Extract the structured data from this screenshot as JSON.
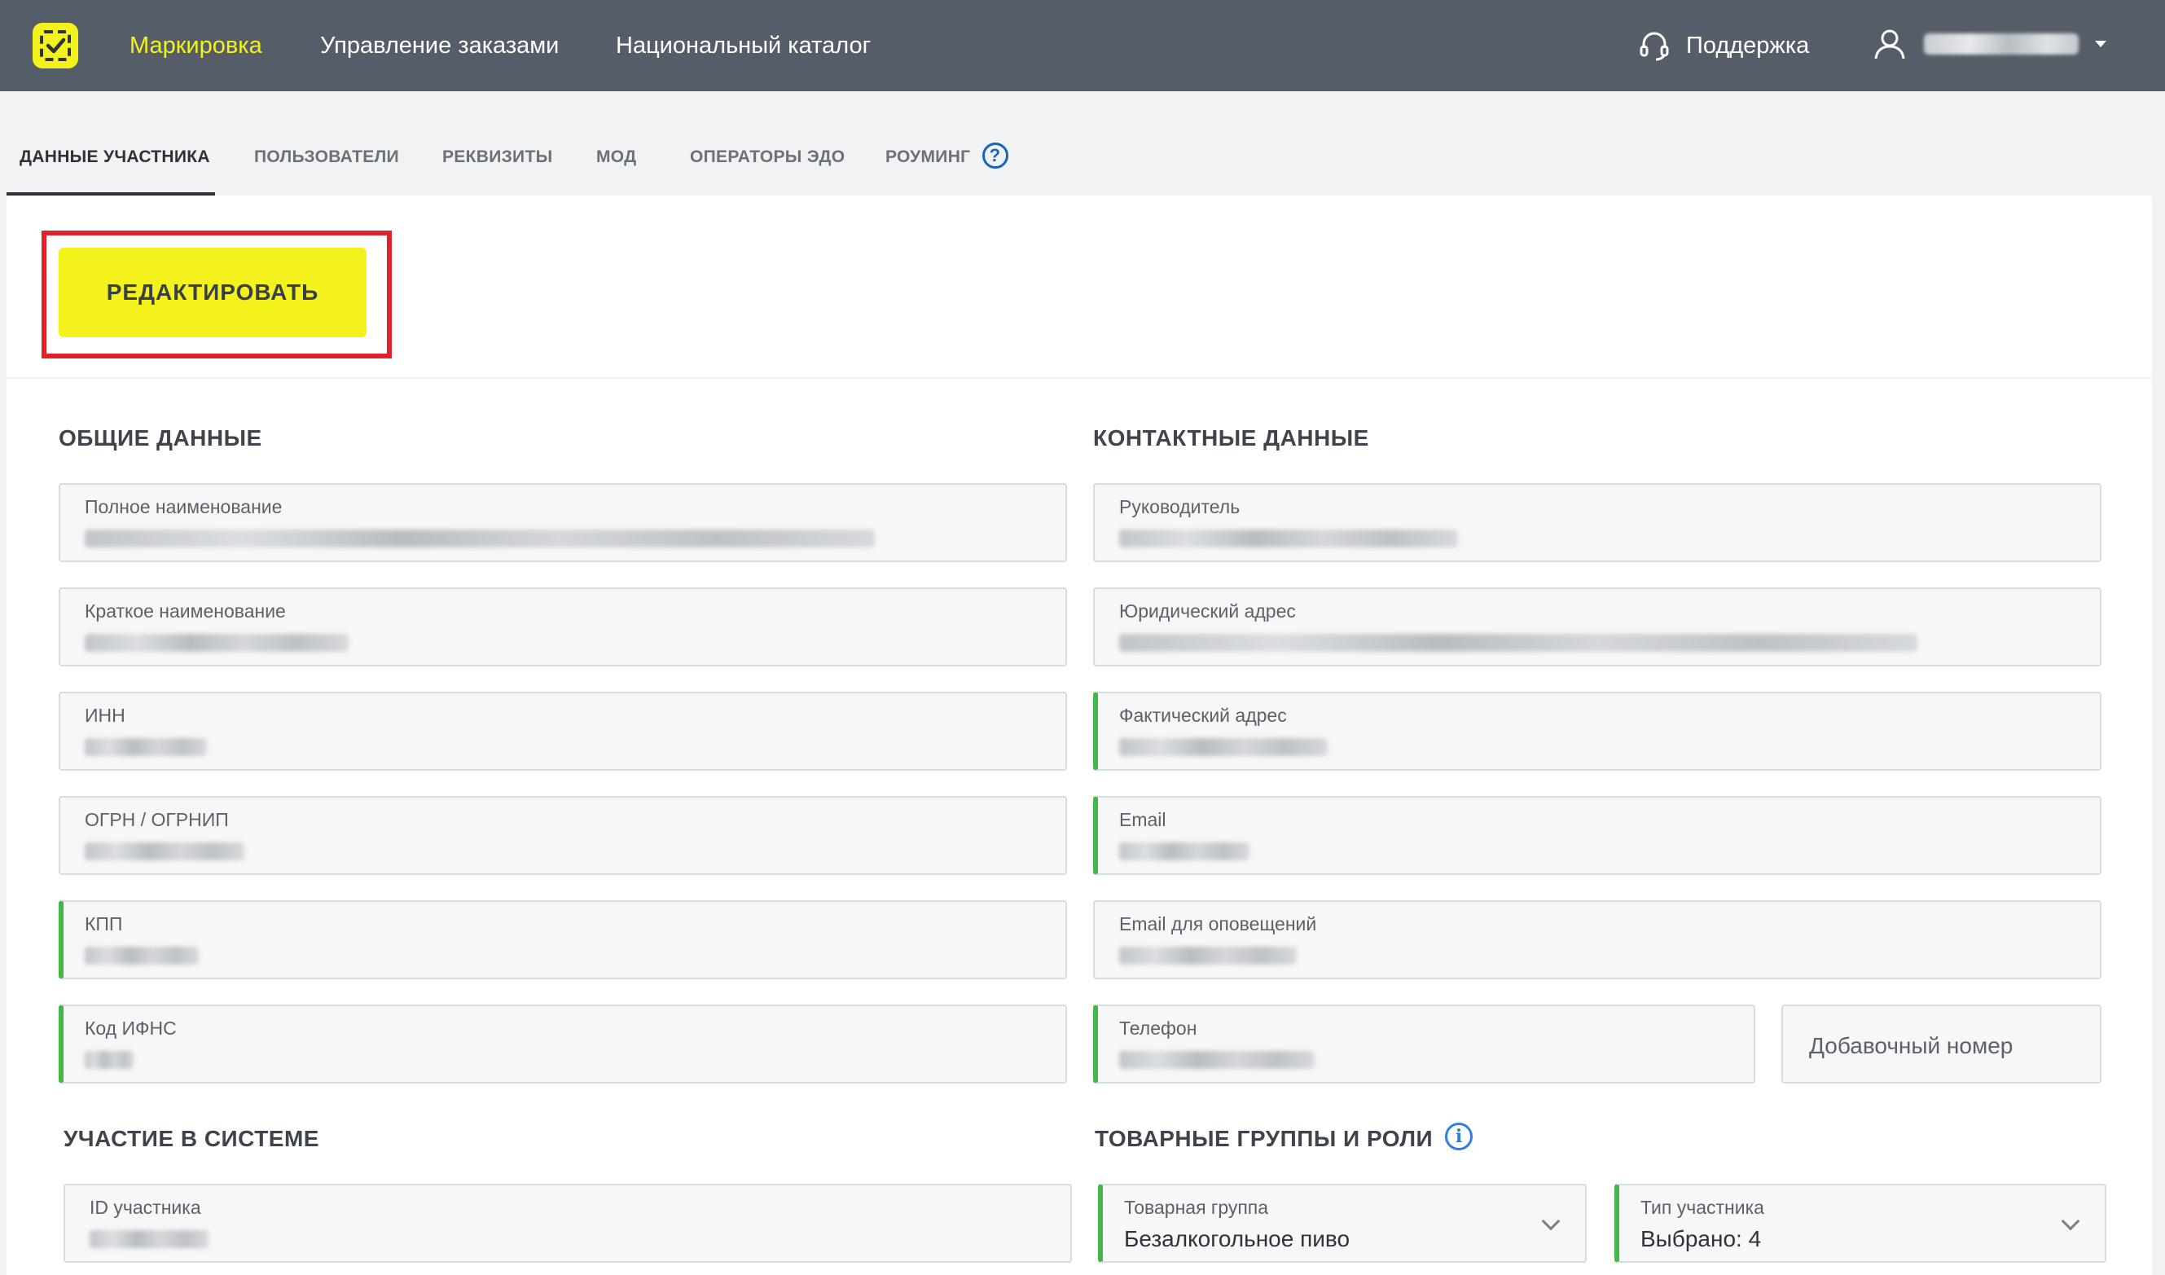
{
  "header": {
    "nav": [
      {
        "label": "Маркировка",
        "active": true
      },
      {
        "label": "Управление заказами",
        "active": false
      },
      {
        "label": "Национальный каталог",
        "active": false
      }
    ],
    "support_label": "Поддержка",
    "accent_color": "#f4f21d",
    "bar_color": "#545d68"
  },
  "tabs": [
    {
      "label": "ДАННЫЕ УЧАСТНИКА",
      "active": true
    },
    {
      "label": "ПОЛЬЗОВАТЕЛИ",
      "active": false
    },
    {
      "label": "РЕКВИЗИТЫ",
      "active": false
    },
    {
      "label": "МОД",
      "active": false
    },
    {
      "label": "ОПЕРАТОРЫ ЭДО",
      "active": false
    },
    {
      "label": "РОУМИНГ",
      "active": false
    }
  ],
  "toolbar": {
    "edit_label": "РЕДАКТИРОВАТЬ"
  },
  "general": {
    "title": "ОБЩИЕ ДАННЫЕ",
    "fields": [
      {
        "label": "Полное наименование"
      },
      {
        "label": "Краткое наименование"
      },
      {
        "label": "ИНН"
      },
      {
        "label": "ОГРН / ОГРНИП"
      },
      {
        "label": "КПП"
      },
      {
        "label": "Код ИФНС"
      }
    ]
  },
  "contacts": {
    "title": "КОНТАКТНЫЕ ДАННЫЕ",
    "fields": [
      {
        "label": "Руководитель"
      },
      {
        "label": "Юридический адрес"
      },
      {
        "label": "Фактический адрес"
      },
      {
        "label": "Email"
      },
      {
        "label": "Email для оповещений"
      },
      {
        "label": "Телефон"
      }
    ],
    "extension_placeholder": "Добавочный номер"
  },
  "participation": {
    "title": "УЧАСТИЕ В СИСТЕМЕ",
    "fields": [
      {
        "label": "ID участника"
      }
    ]
  },
  "groups": {
    "title": "ТОВАРНЫЕ ГРУППЫ И РОЛИ",
    "product_group": {
      "label": "Товарная группа",
      "value": "Безалкогольное пиво"
    },
    "participant_type": {
      "label": "Тип участника",
      "value": "Выбрано: 4"
    }
  }
}
